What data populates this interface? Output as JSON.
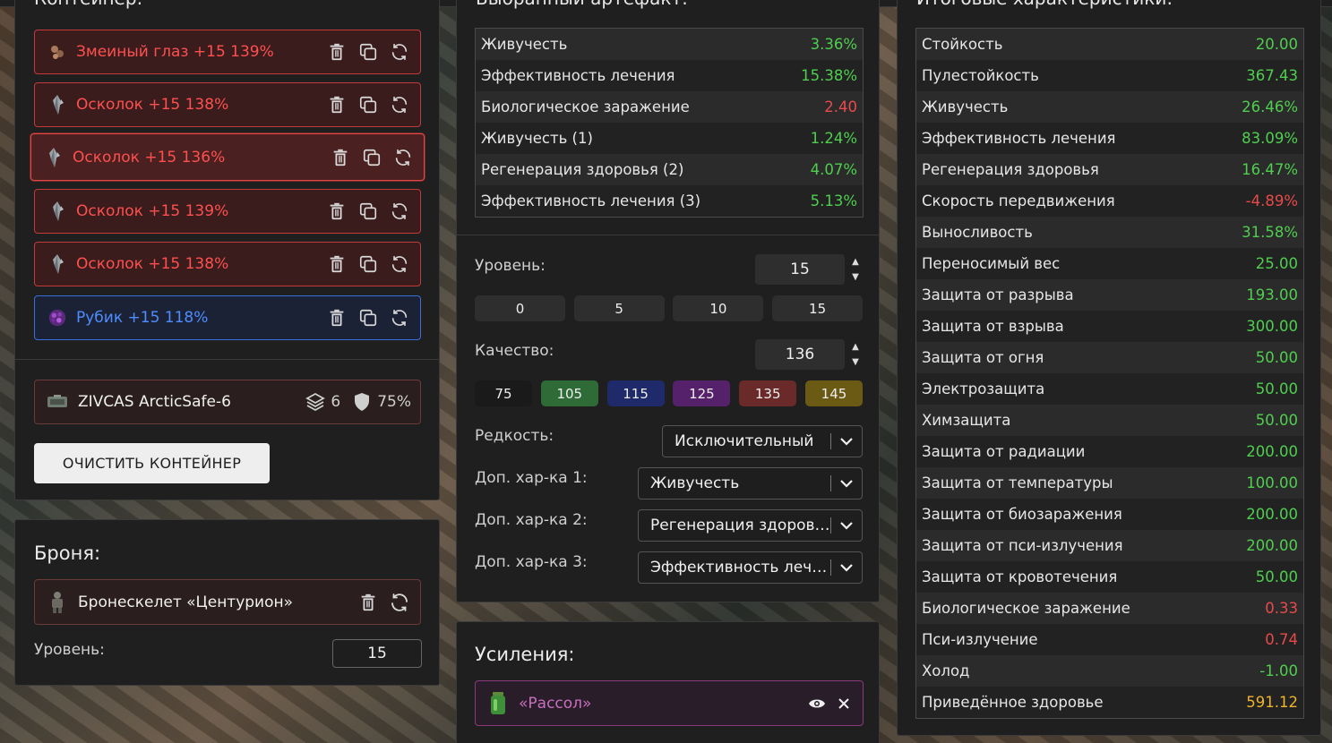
{
  "container": {
    "title": "Контейнер:",
    "artifacts": [
      {
        "name": "Змеиный глаз +15 139%",
        "icon": "snake-eye-artifact-icon",
        "style": "red"
      },
      {
        "name": "Осколок +15 138%",
        "icon": "shard-artifact-icon",
        "style": "red"
      },
      {
        "name": "Осколок +15 136%",
        "icon": "shard-artifact-icon",
        "style": "red-selected"
      },
      {
        "name": "Осколок +15 139%",
        "icon": "shard-artifact-icon",
        "style": "red"
      },
      {
        "name": "Осколок +15 138%",
        "icon": "shard-artifact-icon",
        "style": "red"
      },
      {
        "name": "Рубик +15 118%",
        "icon": "rubik-artifact-icon",
        "style": "blue"
      }
    ],
    "item": {
      "name": "ZIVCAS ArcticSafe-6",
      "slots": "6",
      "protection": "75%"
    },
    "clear_button": "ОЧИСТИТЬ КОНТЕЙНЕР"
  },
  "armor": {
    "title": "Броня:",
    "name": "Бронескелет «Центурион»",
    "level_label": "Уровень:",
    "level_value": "15"
  },
  "selected_artifact": {
    "title": "Выбранный артефакт:",
    "stats": [
      {
        "name": "Живучесть",
        "value": "3.36%",
        "tone": "g"
      },
      {
        "name": "Эффективность лечения",
        "value": "15.38%",
        "tone": "g"
      },
      {
        "name": "Биологическое заражение",
        "value": "2.40",
        "tone": "r"
      },
      {
        "name": "Живучесть (1)",
        "value": "1.24%",
        "tone": "g"
      },
      {
        "name": "Регенерация здоровья (2)",
        "value": "4.07%",
        "tone": "g"
      },
      {
        "name": "Эффективность лечения (3)",
        "value": "5.13%",
        "tone": "g"
      }
    ],
    "level_label": "Уровень:",
    "level_value": "15",
    "level_presets": [
      "0",
      "5",
      "10",
      "15"
    ],
    "quality_label": "Качество:",
    "quality_value": "136",
    "quality_presets": [
      {
        "label": "75",
        "color": "#1a1a1a"
      },
      {
        "label": "105",
        "color": "#2e6b36"
      },
      {
        "label": "115",
        "color": "#1f2a6b"
      },
      {
        "label": "125",
        "color": "#55216b"
      },
      {
        "label": "135",
        "color": "#6b2a2a"
      },
      {
        "label": "145",
        "color": "#6b5a14"
      }
    ],
    "rarity_label": "Редкость:",
    "rarity_value": "Исключительный",
    "extra1_label": "Доп. хар-ка 1:",
    "extra1_value": "Живучесть",
    "extra2_label": "Доп. хар-ка 2:",
    "extra2_value": "Регенерация здоровья",
    "extra3_label": "Доп. хар-ка 3:",
    "extra3_value": "Эффективность лечения"
  },
  "boosts": {
    "title": "Усиления:",
    "item": "«Рассол»"
  },
  "final_stats": {
    "title": "Итоговые характеристики:",
    "rows": [
      {
        "name": "Стойкость",
        "value": "20.00",
        "tone": "g"
      },
      {
        "name": "Пулестойкость",
        "value": "367.43",
        "tone": "g"
      },
      {
        "name": "Живучесть",
        "value": "26.46%",
        "tone": "g"
      },
      {
        "name": "Эффективность лечения",
        "value": "83.09%",
        "tone": "g"
      },
      {
        "name": "Регенерация здоровья",
        "value": "16.47%",
        "tone": "g"
      },
      {
        "name": "Скорость передвижения",
        "value": "-4.89%",
        "tone": "r"
      },
      {
        "name": "Выносливость",
        "value": "31.58%",
        "tone": "g"
      },
      {
        "name": "Переносимый вес",
        "value": "25.00",
        "tone": "g"
      },
      {
        "name": "Защита от разрыва",
        "value": "193.00",
        "tone": "g"
      },
      {
        "name": "Защита от взрыва",
        "value": "300.00",
        "tone": "g"
      },
      {
        "name": "Защита от огня",
        "value": "50.00",
        "tone": "g"
      },
      {
        "name": "Электрозащита",
        "value": "50.00",
        "tone": "g"
      },
      {
        "name": "Химзащита",
        "value": "50.00",
        "tone": "g"
      },
      {
        "name": "Защита от радиации",
        "value": "200.00",
        "tone": "g"
      },
      {
        "name": "Защита от температуры",
        "value": "100.00",
        "tone": "g"
      },
      {
        "name": "Защита от биозаражения",
        "value": "200.00",
        "tone": "g"
      },
      {
        "name": "Защита от пси-излучения",
        "value": "200.00",
        "tone": "g"
      },
      {
        "name": "Защита от кровотечения",
        "value": "50.00",
        "tone": "g"
      },
      {
        "name": "Биологическое заражение",
        "value": "0.33",
        "tone": "r"
      },
      {
        "name": "Пси-излучение",
        "value": "0.74",
        "tone": "r"
      },
      {
        "name": "Холод",
        "value": "-1.00",
        "tone": "g"
      },
      {
        "name": "Приведённое здоровье",
        "value": "591.12",
        "tone": "y"
      }
    ]
  }
}
